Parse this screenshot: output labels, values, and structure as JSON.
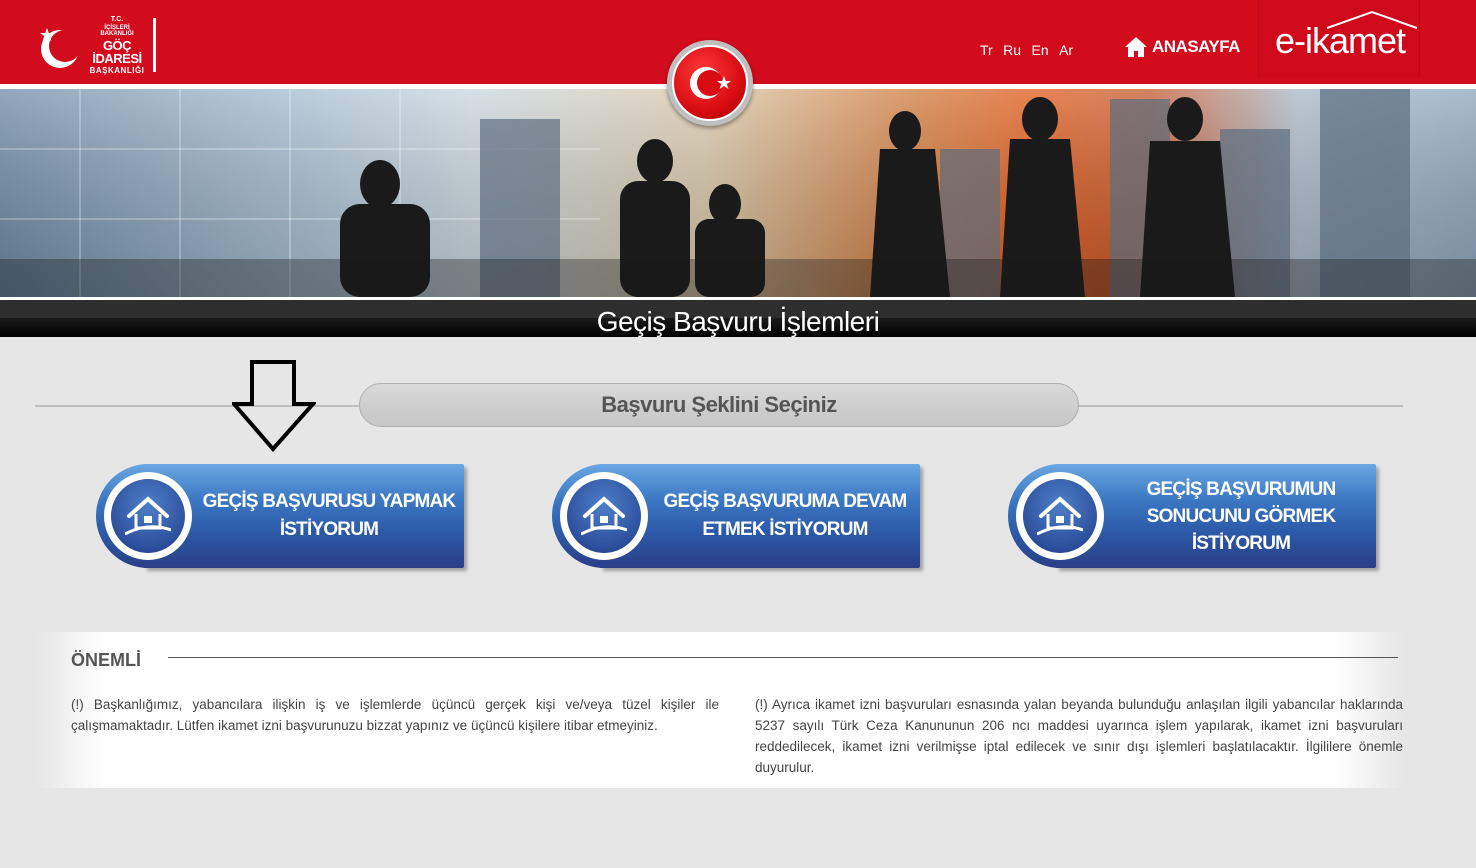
{
  "header": {
    "logo": {
      "line1": "T.C.",
      "line2": "İÇİŞLERİ BAKANLIĞI",
      "line3": "GÖÇ İDARESİ",
      "line4": "BAŞKANLIĞI"
    },
    "languages": [
      "Tr",
      "Ru",
      "En",
      "Ar"
    ],
    "home_label": "ANASAYFA",
    "brand_label": "e-ikamet"
  },
  "banner": {
    "title": "Geçiş Başvuru İşlemleri"
  },
  "selection": {
    "prompt": "Başvuru Şeklini Seçiniz",
    "buttons": [
      {
        "label": "GEÇİŞ BAŞVURUSU YAPMAK\nİSTİYORUM"
      },
      {
        "label": "GEÇİŞ BAŞVURUMA DEVAM\nETMEK İSTİYORUM"
      },
      {
        "label": "GEÇİŞ BAŞVURUMUN\nSONUCUNU GÖRMEK\nİSTİYORUM"
      }
    ]
  },
  "notice": {
    "heading": "ÖNEMLİ",
    "left_text": "(!) Başkanlığımız, yabancılara ilişkin iş ve işlemlerde üçüncü gerçek kişi ve/veya tüzel kişiler ile çalışmamaktadır. Lütfen ikamet izni başvurunuzu bizzat yapınız ve üçüncü kişilere itibar etmeyiniz.",
    "right_text": "(!) Ayrıca ikamet izni başvuruları esnasında yalan beyanda bulunduğu anlaşılan ilgili yabancılar haklarında 5237 sayılı Türk Ceza Kanununun 206 ncı maddesi uyarınca işlem yapılarak, ikamet izni başvuruları reddedilecek, ikamet izni verilmişse iptal edilecek ve sınır dışı işlemleri başlatılacaktır. İlgililere önemle duyurulur."
  },
  "colors": {
    "header_red": "#d20b1d",
    "button_blue": "#2d5aa8",
    "page_bg": "#e6e6e6"
  }
}
